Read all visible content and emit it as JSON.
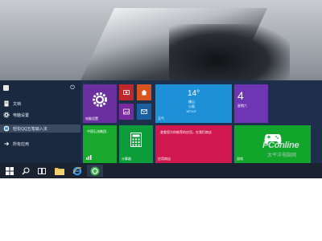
{
  "start_menu": {
    "user": {
      "name": ""
    },
    "items": [
      {
        "label": "文档",
        "icon": "document-icon"
      },
      {
        "label": "电脑设置",
        "icon": "gear-icon"
      },
      {
        "label": "轻松QQ五笔输入法",
        "icon": "qq-input-icon"
      },
      {
        "label": "所有应用",
        "icon": "arrow-right-icon"
      }
    ]
  },
  "tiles": {
    "settings": {
      "label": "电脑设置"
    },
    "weather": {
      "temp": "14°",
      "city": "佛山",
      "condition": "小雨",
      "range": "16°/13°",
      "label": "天气"
    },
    "calendar": {
      "day_number": "4",
      "day_name": "星期六"
    },
    "green1": {
      "text": "中国石油集团..."
    },
    "calc": {
      "label": "计算器"
    },
    "store": {
      "text": "查看您为你推荐的应用，在我们商店",
      "label": "应用商店"
    },
    "xbox": {
      "label": "游戏"
    }
  },
  "taskbar": {
    "buttons": [
      "start-icon",
      "search-icon",
      "task-view-icon",
      "file-explorer-icon",
      "ie-icon",
      "app-icon"
    ]
  },
  "watermark": {
    "main": "PConline",
    "sub": "太平洋电脑网"
  },
  "colors": {
    "accent": "#1d2f4a",
    "tile_purple": "#6b2fa0",
    "tile_blue": "#1e90d8",
    "tile_green": "#17a82d",
    "tile_red": "#d0174e"
  }
}
